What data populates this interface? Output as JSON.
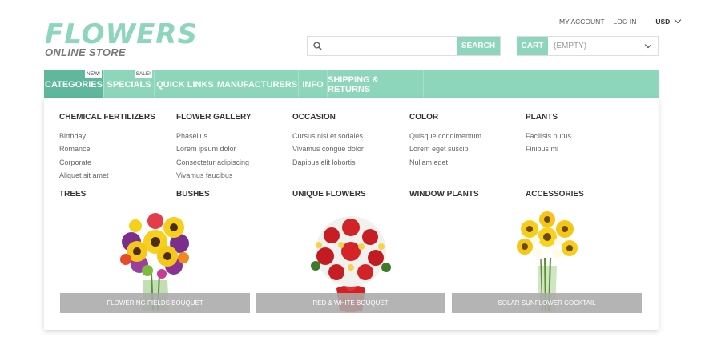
{
  "logo": {
    "title": "FLOWERS",
    "subtitle": "ONLINE STORE"
  },
  "header": {
    "my_account": "MY ACCOUNT",
    "log_in": "LOG IN",
    "currency": "USD"
  },
  "search": {
    "value": "",
    "placeholder": "",
    "button": "SEARCH"
  },
  "cart": {
    "label": "CART",
    "value": "(EMPTY)"
  },
  "nav": [
    {
      "label": "CATEGORIES",
      "badge": "NEW!"
    },
    {
      "label": "SPECIALS",
      "badge": "SALE!"
    },
    {
      "label": "QUICK LINKS"
    },
    {
      "label": "MANUFACTURERS"
    },
    {
      "label": "INFO"
    },
    {
      "label": "SHIPPING & RETURNS"
    }
  ],
  "columns": [
    {
      "title": "CHEMICAL FERTILIZERS",
      "links": [
        "Birthday",
        "Romance",
        "Corporate",
        "Aliquet sit amet"
      ]
    },
    {
      "title": "FLOWER GALLERY",
      "links": [
        "Phasellus",
        "Lorem ipsum dolor",
        "Consectetur adipiscing",
        "Vivamus faucibus"
      ]
    },
    {
      "title": "OCCASION",
      "links": [
        "Cursus nisi et sodales",
        "Vivamus congue dolor",
        "Dapibus elit lobortis"
      ]
    },
    {
      "title": "COLOR",
      "links": [
        "Quisque condimentum",
        "Lorem eget suscip",
        "Nullam eget"
      ]
    },
    {
      "title": "PLANTS",
      "links": [
        "Facilisis purus",
        "Finibus mi"
      ]
    }
  ],
  "subheadings": [
    "TREES",
    "BUSHES",
    "UNIQUE FLOWERS",
    "WINDOW PLANTS",
    "ACCESSORIES"
  ],
  "products": [
    {
      "label": "FLOWERING FIELDS BOUQUET"
    },
    {
      "label": "RED & WHITE BOUQUET"
    },
    {
      "label": "SOLAR SUNFLOWER COCKTAIL"
    }
  ],
  "colors": {
    "accent": "#8dd5bb",
    "accent_dark": "#5fb89b",
    "label_bg": "#aaaaaa"
  }
}
